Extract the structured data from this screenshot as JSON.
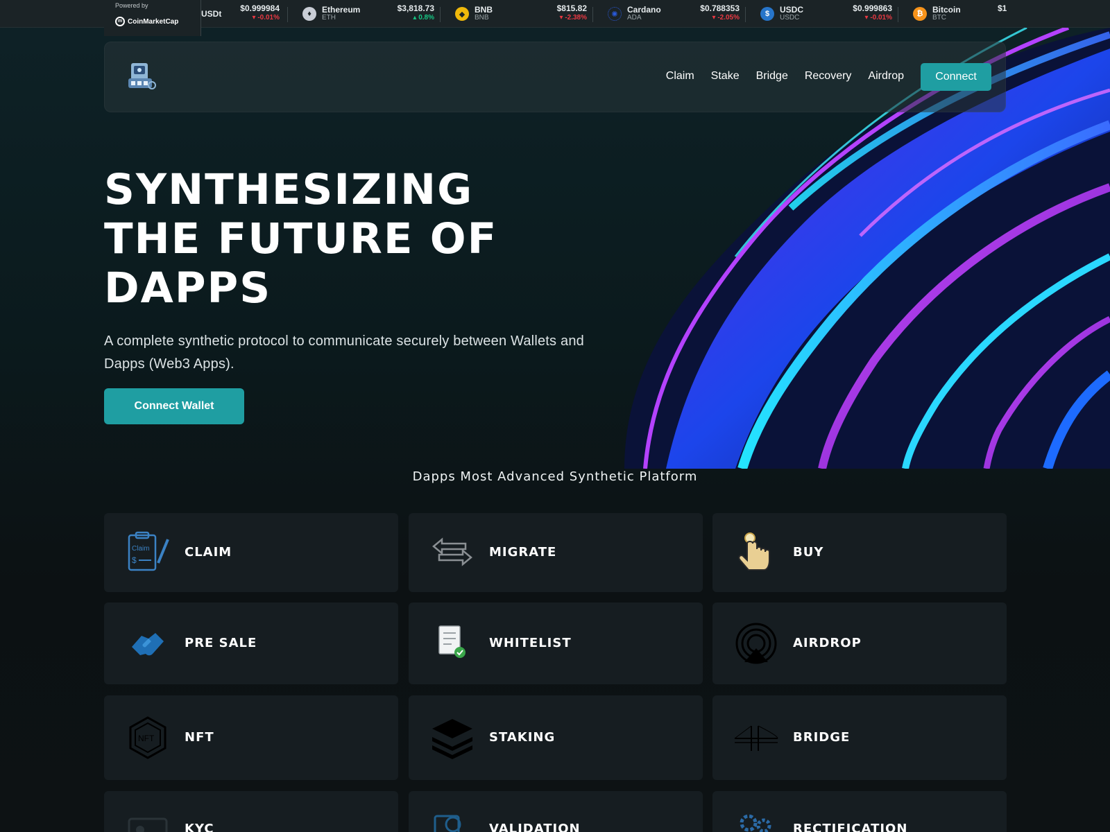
{
  "ticker": {
    "powered_by": "Powered by",
    "brand": "CoinMarketCap",
    "items": [
      {
        "name": "USDt",
        "symbol": "",
        "price": "$0.999984",
        "change": "-0.01%",
        "direction": "down",
        "color": "#26a17b"
      },
      {
        "name": "Ethereum",
        "symbol": "ETH",
        "price": "$3,818.73",
        "change": "0.8%",
        "direction": "up",
        "color": "#c9ced6"
      },
      {
        "name": "BNB",
        "symbol": "BNB",
        "price": "$815.82",
        "change": "-2.38%",
        "direction": "down",
        "color": "#f0b90b"
      },
      {
        "name": "Cardano",
        "symbol": "ADA",
        "price": "$0.788353",
        "change": "-2.05%",
        "direction": "down",
        "color": "#2a5ada"
      },
      {
        "name": "USDC",
        "symbol": "USDC",
        "price": "$0.999863",
        "change": "-0.01%",
        "direction": "down",
        "color": "#2775ca"
      },
      {
        "name": "Bitcoin",
        "symbol": "BTC",
        "price": "$1",
        "change": "",
        "direction": "down",
        "color": "#f7931a"
      }
    ]
  },
  "nav": {
    "links": [
      "Claim",
      "Stake",
      "Bridge",
      "Recovery",
      "Airdrop"
    ],
    "connect": "Connect"
  },
  "hero": {
    "title_lines": [
      "SYNTHESIZING",
      "THE FUTURE OF",
      "DAPPS"
    ],
    "subtitle": "A complete synthetic protocol to communicate securely between Wallets and Dapps (Web3 Apps).",
    "button": "Connect Wallet"
  },
  "section_title": "Dapps Most Advanced Synthetic Platform",
  "cards": [
    {
      "label": "CLAIM",
      "icon": "claim-clipboard-icon"
    },
    {
      "label": "MIGRATE",
      "icon": "migrate-arrows-icon"
    },
    {
      "label": "BUY",
      "icon": "tap-hand-icon"
    },
    {
      "label": "PRE SALE",
      "icon": "handshake-icon"
    },
    {
      "label": "WHITELIST",
      "icon": "document-check-icon"
    },
    {
      "label": "AIRDROP",
      "icon": "airdrop-signal-icon"
    },
    {
      "label": "NFT",
      "icon": "nft-hexagon-icon"
    },
    {
      "label": "STAKING",
      "icon": "layers-stack-icon"
    },
    {
      "label": "BRIDGE",
      "icon": "bridge-icon"
    },
    {
      "label": "KYC",
      "icon": "id-card-icon"
    },
    {
      "label": "VALIDATION",
      "icon": "validation-chart-icon"
    },
    {
      "label": "RECTIFICATION",
      "icon": "gears-icon"
    }
  ],
  "colors": {
    "accent": "#1f9ea2",
    "card": "#161d21",
    "up": "#16c784",
    "down": "#ea3943"
  }
}
